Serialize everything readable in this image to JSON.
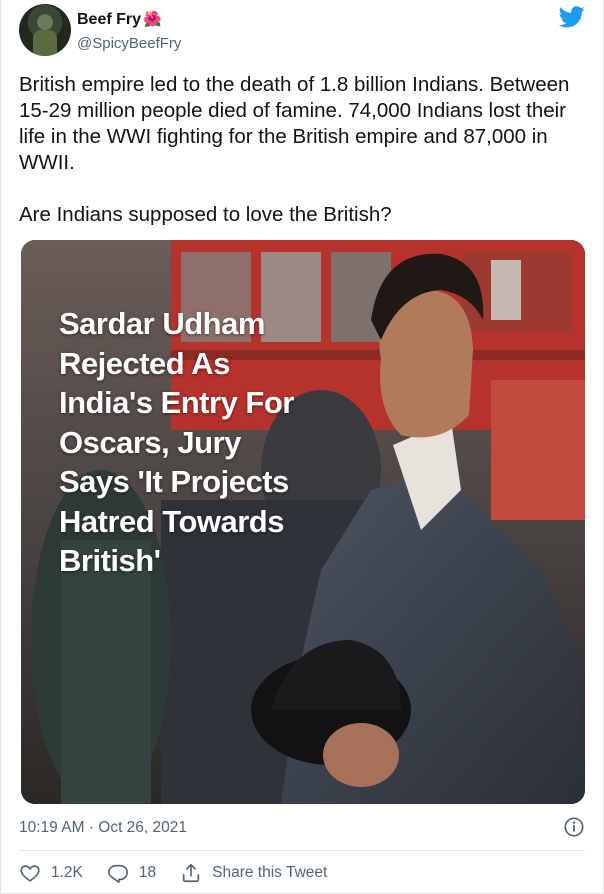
{
  "author": {
    "display_name": "Beef Fry",
    "name_emoji": "🌺",
    "handle": "@SpicyBeefFry",
    "avatar_icon": "profile-avatar"
  },
  "platform_icon": "twitter-bird-icon",
  "colors": {
    "brand": "#1d9bf0",
    "muted": "#536471",
    "text": "#0f1419",
    "divider": "#e1e8ed"
  },
  "tweet": {
    "paragraphs": [
      "British empire led to the death of 1.8 billion Indians. Between 15-29 million people died of famine. 74,000 Indians lost their life in the WWI fighting for the British empire and 87,000 in WWII.",
      "Are Indians supposed to love the British?"
    ]
  },
  "media": {
    "overlay_lines": [
      "Sardar Udham",
      "Rejected As",
      "India's Entry For",
      "Oscars, Jury",
      "Says 'It Projects",
      "Hatred Towards",
      "British'"
    ]
  },
  "meta": {
    "timestamp": "10:19 AM · Oct 26, 2021"
  },
  "actions": {
    "likes": "1.2K",
    "replies": "18",
    "share_label": "Share this Tweet"
  }
}
